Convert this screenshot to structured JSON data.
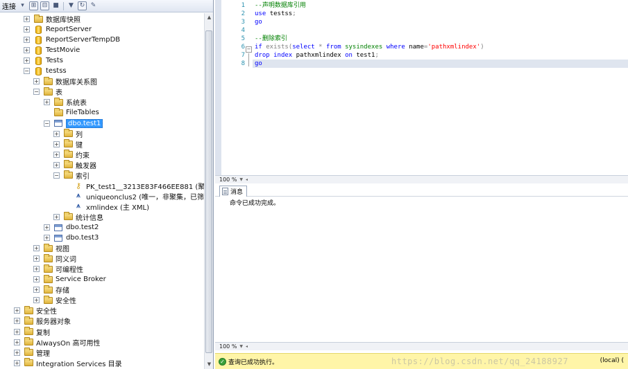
{
  "object_explorer": {
    "toolbar": {
      "connect_label": "连接"
    },
    "tree": [
      {
        "label": "数据库快照",
        "icon": "folder",
        "expand": "+"
      },
      {
        "label": "ReportServer",
        "icon": "database",
        "expand": "+"
      },
      {
        "label": "ReportServerTempDB",
        "icon": "database",
        "expand": "+"
      },
      {
        "label": "TestMovie",
        "icon": "database",
        "expand": "+"
      },
      {
        "label": "Tests",
        "icon": "database",
        "expand": "+"
      },
      {
        "label": "testss",
        "icon": "database",
        "expand": "-"
      },
      {
        "label": "数据库关系图",
        "icon": "folder",
        "expand": "+"
      },
      {
        "label": "表",
        "icon": "folder",
        "expand": "-"
      },
      {
        "label": "系统表",
        "icon": "folder",
        "expand": "+"
      },
      {
        "label": "FileTables",
        "icon": "folder",
        "expand": ""
      },
      {
        "label": "dbo.test1",
        "icon": "table",
        "expand": "-",
        "selected": true
      },
      {
        "label": "列",
        "icon": "folder",
        "expand": "+"
      },
      {
        "label": "键",
        "icon": "folder",
        "expand": "+"
      },
      {
        "label": "约束",
        "icon": "folder",
        "expand": "+"
      },
      {
        "label": "触发器",
        "icon": "folder",
        "expand": "+"
      },
      {
        "label": "索引",
        "icon": "folder",
        "expand": "-"
      },
      {
        "label": "PK_test1__3213E83F466EE881 (聚集)",
        "icon": "key",
        "expand": ""
      },
      {
        "label": "uniqueonclus2 (唯一，非聚集，已筛选)",
        "icon": "index",
        "expand": ""
      },
      {
        "label": "xmlindex (主 XML)",
        "icon": "index",
        "expand": ""
      },
      {
        "label": "统计信息",
        "icon": "folder",
        "expand": "+"
      },
      {
        "label": "dbo.test2",
        "icon": "table",
        "expand": "+"
      },
      {
        "label": "dbo.test3",
        "icon": "table",
        "expand": "+"
      },
      {
        "label": "视图",
        "icon": "folder",
        "expand": "+"
      },
      {
        "label": "同义词",
        "icon": "folder",
        "expand": "+"
      },
      {
        "label": "可编程性",
        "icon": "folder",
        "expand": "+"
      },
      {
        "label": "Service Broker",
        "icon": "folder",
        "expand": "+"
      },
      {
        "label": "存储",
        "icon": "folder",
        "expand": "+"
      },
      {
        "label": "安全性",
        "icon": "folder",
        "expand": "+"
      },
      {
        "label": "安全性",
        "icon": "folder",
        "expand": "+"
      },
      {
        "label": "服务器对象",
        "icon": "folder",
        "expand": "+"
      },
      {
        "label": "复制",
        "icon": "folder",
        "expand": "+"
      },
      {
        "label": "AlwaysOn 高可用性",
        "icon": "folder",
        "expand": "+"
      },
      {
        "label": "管理",
        "icon": "folder",
        "expand": "+"
      },
      {
        "label": "Integration Services 目录",
        "icon": "folder",
        "expand": "+"
      }
    ]
  },
  "editor": {
    "line_numbers": [
      "1",
      "2",
      "3",
      "4",
      "5",
      "6",
      "7",
      "8"
    ],
    "lines": {
      "l1": "--声明数据库引用",
      "l2_kw": "use",
      "l2_obj": "testss",
      "l2_semi": ";",
      "l3": "go",
      "l5": "--删除索引",
      "l6_if": "if",
      "l6_exists": "exists",
      "l6_open": "(",
      "l6_select": "select",
      "l6_star": " * ",
      "l6_from": "from",
      "l6_sys": "sysindexes",
      "l6_where": "where",
      "l6_name": "name",
      "l6_eq": "=",
      "l6_str": "'pathxmlindex'",
      "l6_close": ")",
      "l7_drop": "drop",
      "l7_index": "index",
      "l7_idx": "pathxmlindex",
      "l7_on": "on",
      "l7_tbl": "test1",
      "l7_semi": ";",
      "l8": "go"
    },
    "zoom": "100 %"
  },
  "results": {
    "tab_label": "消息",
    "message": "命令已成功完成。",
    "zoom": "100 %"
  },
  "status_bar": {
    "text": "查询已成功执行。",
    "server": "(local) (",
    "watermark": "https://blog.csdn.net/qq_24188927"
  }
}
